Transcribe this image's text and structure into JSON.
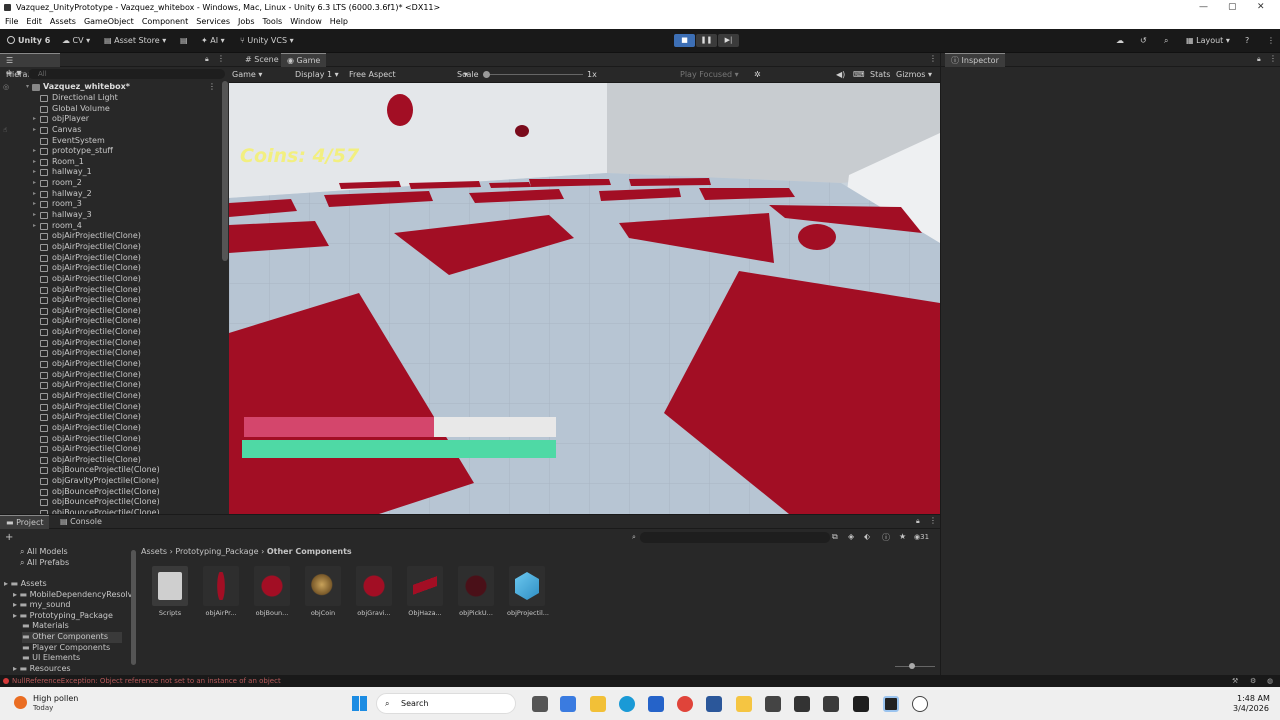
{
  "window": {
    "title": "Vazquez_UnityPrototype - Vazquez_whitebox - Windows, Mac, Linux - Unity 6.3 LTS (6000.3.6f1)* <DX11>"
  },
  "menu": [
    "File",
    "Edit",
    "Assets",
    "GameObject",
    "Component",
    "Services",
    "Jobs",
    "Tools",
    "Window",
    "Help"
  ],
  "toolbar": {
    "unity_label": "Unity 6",
    "account_label": "CV",
    "asset_store_label": "Asset Store",
    "ai_label": "AI",
    "vcs_label": "Unity VCS",
    "layout_label": "Layout"
  },
  "hierarchy": {
    "tab_label": "Hierarchy",
    "search_placeholder": "All",
    "scene_name": "Vazquez_whitebox*",
    "items": [
      {
        "label": "Directional Light",
        "expandable": false
      },
      {
        "label": "Global Volume",
        "expandable": false
      },
      {
        "label": "objPlayer",
        "expandable": true
      },
      {
        "label": "Canvas",
        "expandable": true
      },
      {
        "label": "EventSystem",
        "expandable": false
      },
      {
        "label": "prototype_stuff",
        "expandable": true
      },
      {
        "label": "Room_1",
        "expandable": true
      },
      {
        "label": "hallway_1",
        "expandable": true
      },
      {
        "label": "room_2",
        "expandable": true
      },
      {
        "label": "hallway_2",
        "expandable": true
      },
      {
        "label": "room_3",
        "expandable": true
      },
      {
        "label": "hallway_3",
        "expandable": true
      },
      {
        "label": "room_4",
        "expandable": true
      },
      {
        "label": "objAirProjectile(Clone)",
        "expandable": false
      },
      {
        "label": "objAirProjectile(Clone)",
        "expandable": false
      },
      {
        "label": "objAirProjectile(Clone)",
        "expandable": false
      },
      {
        "label": "objAirProjectile(Clone)",
        "expandable": false
      },
      {
        "label": "objAirProjectile(Clone)",
        "expandable": false
      },
      {
        "label": "objAirProjectile(Clone)",
        "expandable": false
      },
      {
        "label": "objAirProjectile(Clone)",
        "expandable": false
      },
      {
        "label": "objAirProjectile(Clone)",
        "expandable": false
      },
      {
        "label": "objAirProjectile(Clone)",
        "expandable": false
      },
      {
        "label": "objAirProjectile(Clone)",
        "expandable": false
      },
      {
        "label": "objAirProjectile(Clone)",
        "expandable": false
      },
      {
        "label": "objAirProjectile(Clone)",
        "expandable": false
      },
      {
        "label": "objAirProjectile(Clone)",
        "expandable": false
      },
      {
        "label": "objAirProjectile(Clone)",
        "expandable": false
      },
      {
        "label": "objAirProjectile(Clone)",
        "expandable": false
      },
      {
        "label": "objAirProjectile(Clone)",
        "expandable": false
      },
      {
        "label": "objAirProjectile(Clone)",
        "expandable": false
      },
      {
        "label": "objAirProjectile(Clone)",
        "expandable": false
      },
      {
        "label": "objAirProjectile(Clone)",
        "expandable": false
      },
      {
        "label": "objAirProjectile(Clone)",
        "expandable": false
      },
      {
        "label": "objAirProjectile(Clone)",
        "expandable": false
      },
      {
        "label": "objAirProjectile(Clone)",
        "expandable": false
      },
      {
        "label": "objBounceProjectile(Clone)",
        "expandable": false
      },
      {
        "label": "objGravityProjectile(Clone)",
        "expandable": false
      },
      {
        "label": "objBounceProjectile(Clone)",
        "expandable": false
      },
      {
        "label": "objBounceProjectile(Clone)",
        "expandable": false
      },
      {
        "label": "objBounceProjectile(Clone)",
        "expandable": false
      }
    ]
  },
  "scene_tab_label": "Scene",
  "game": {
    "tab_label": "Game",
    "mode_label": "Game",
    "display_label": "Display 1",
    "aspect_label": "Free Aspect",
    "scale_label": "Scale",
    "scale_value": "1x",
    "play_focused_label": "Play Focused",
    "stats_label": "Stats",
    "gizmos_label": "Gizmos",
    "coins_text": "Coins: 4/57",
    "health_fraction": 0.61,
    "stamina_fraction": 1.0
  },
  "inspector": {
    "tab_label": "Inspector"
  },
  "project": {
    "tab_label": "Project",
    "console_tab_label": "Console",
    "favorites": [
      "All Models",
      "All Prefabs"
    ],
    "tree": [
      {
        "label": "Assets",
        "depth": 0
      },
      {
        "label": "MobileDependencyResolv",
        "depth": 1
      },
      {
        "label": "my_sound",
        "depth": 1
      },
      {
        "label": "Prototyping_Package",
        "depth": 1
      },
      {
        "label": "Materials",
        "depth": 2
      },
      {
        "label": "Other Components",
        "depth": 2
      },
      {
        "label": "Player Components",
        "depth": 2
      },
      {
        "label": "UI Elements",
        "depth": 2
      },
      {
        "label": "Resources",
        "depth": 1
      }
    ],
    "breadcrumb": [
      "Assets",
      "Prototyping_Package",
      "Other Components"
    ],
    "asset_count": "31",
    "assets": [
      {
        "label": "Scripts",
        "icon": "folder-icon"
      },
      {
        "label": "objAirPr...",
        "icon": "prefab-icon"
      },
      {
        "label": "objBoun...",
        "icon": "prefab-icon"
      },
      {
        "label": "objCoin",
        "icon": "prefab-icon"
      },
      {
        "label": "objGravi...",
        "icon": "prefab-icon"
      },
      {
        "label": "ObjHaza...",
        "icon": "prefab-icon"
      },
      {
        "label": "objPickU...",
        "icon": "prefab-icon"
      },
      {
        "label": "objProjectil...",
        "icon": "prefab-icon"
      }
    ]
  },
  "status": {
    "error_text": "NullReferenceException: Object reference not set to an instance of an object"
  },
  "taskbar": {
    "weather_title": "High pollen",
    "weather_sub": "Today",
    "search_label": "Search",
    "time": "1:48 AM",
    "date": "3/4/2026"
  },
  "colors": {
    "accent": "#3d6fb5",
    "red_tile": "#a20e24",
    "health": "#d4466c",
    "stamina": "#4fd9a5",
    "coins": "#f2ef80"
  }
}
